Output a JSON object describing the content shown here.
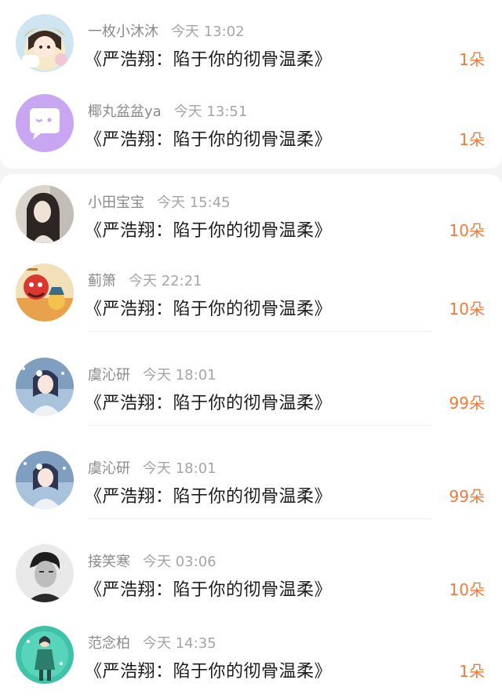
{
  "rows": [
    {
      "user": "一枚小沐沐",
      "time": "今天 13:02",
      "book": "《严浩翔：陷于你的彻骨温柔》",
      "gift": "1朵",
      "avatar": "cartoon-girl-avatar"
    },
    {
      "user": "椰丸盆盆ya",
      "time": "今天 13:51",
      "book": "《严浩翔：陷于你的彻骨温柔》",
      "gift": "1朵",
      "avatar": "default-chat-avatar"
    },
    {
      "user": "小田宝宝",
      "time": "今天 15:45",
      "book": "《严浩翔：陷于你的彻骨温柔》",
      "gift": "10朵",
      "avatar": "portrait-avatar"
    },
    {
      "user": "蓟箫",
      "time": "今天 22:21",
      "book": "《严浩翔：陷于你的彻骨温柔》",
      "gift": "10朵",
      "avatar": "illustration-avatar"
    },
    {
      "user": "虞沁研",
      "time": "今天 18:01",
      "book": "《严浩翔：陷于你的彻骨温柔》",
      "gift": "99朵",
      "avatar": "anime-girl-avatar"
    },
    {
      "user": "虞沁研",
      "time": "今天 18:01",
      "book": "《严浩翔：陷于你的彻骨温柔》",
      "gift": "99朵",
      "avatar": "anime-girl-avatar"
    },
    {
      "user": "接笑寒",
      "time": "今天 03:06",
      "book": "《严浩翔：陷于你的彻骨温柔》",
      "gift": "10朵",
      "avatar": "bw-portrait-avatar"
    },
    {
      "user": "范念柏",
      "time": "今天 14:35",
      "book": "《严浩翔：陷于你的彻骨温柔》",
      "gift": "1朵",
      "avatar": "teal-figure-avatar"
    }
  ]
}
